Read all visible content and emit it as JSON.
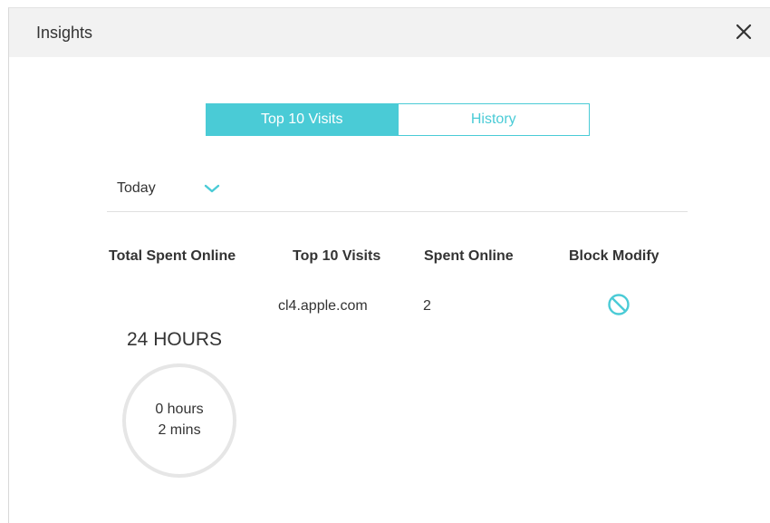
{
  "dialog": {
    "title": "Insights",
    "close_icon": "close-icon"
  },
  "tabs": [
    {
      "label": "Top 10 Visits",
      "active": true
    },
    {
      "label": "History",
      "active": false
    }
  ],
  "period": {
    "selected": "Today",
    "icon": "chevron-down-icon"
  },
  "table": {
    "headers": [
      "Total Spent Online",
      "Top 10 Visits",
      "Spent Online",
      "Block Modify"
    ],
    "rows": [
      {
        "site": "cl4.apple.com",
        "spent": "2",
        "block_icon": "block-icon"
      }
    ]
  },
  "summary": {
    "total_label": "24 HOURS",
    "ring_line1": "0 hours",
    "ring_line2": "2 mins"
  },
  "colors": {
    "accent": "#4acbd6",
    "header_bg": "#f2f2f2",
    "text": "#333333",
    "ring": "#e6e6e6"
  }
}
